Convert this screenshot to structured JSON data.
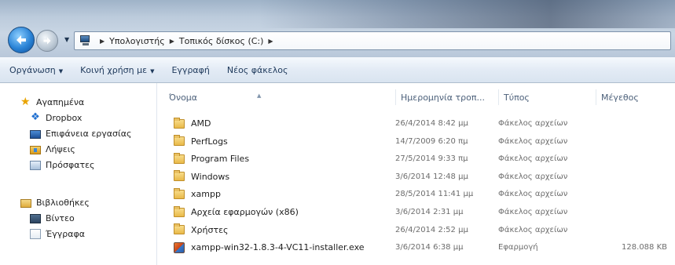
{
  "address": {
    "segments": [
      "Υπολογιστής",
      "Τοπικός δίσκος (C:)"
    ]
  },
  "toolbar": {
    "organize_label": "Οργάνωση",
    "share_label": "Κοινή χρήση με",
    "burn_label": "Εγγραφή",
    "new_folder_label": "Νέος φάκελος"
  },
  "navpane": {
    "favorites_label": "Αγαπημένα",
    "favorites": [
      "Dropbox",
      "Επιφάνεια εργασίας",
      "Λήψεις",
      "Πρόσφατες"
    ],
    "libraries_label": "Βιβλιοθήκες",
    "libraries": [
      "Βίντεο",
      "Έγγραφα"
    ]
  },
  "columns": {
    "name": "Όνομα",
    "date": "Ημερομηνία τροπ...",
    "type": "Τύπος",
    "size": "Μέγεθος"
  },
  "files": [
    {
      "name": "AMD",
      "date": "26/4/2014 8:42 μμ",
      "type": "Φάκελος αρχείων",
      "size": "",
      "icon": "folder-icon"
    },
    {
      "name": "PerfLogs",
      "date": "14/7/2009 6:20 πμ",
      "type": "Φάκελος αρχείων",
      "size": "",
      "icon": "folder-icon"
    },
    {
      "name": "Program Files",
      "date": "27/5/2014 9:33 πμ",
      "type": "Φάκελος αρχείων",
      "size": "",
      "icon": "folder-icon"
    },
    {
      "name": "Windows",
      "date": "3/6/2014 12:48 μμ",
      "type": "Φάκελος αρχείων",
      "size": "",
      "icon": "folder-icon"
    },
    {
      "name": "xampp",
      "date": "28/5/2014 11:41 μμ",
      "type": "Φάκελος αρχείων",
      "size": "",
      "icon": "folder-icon"
    },
    {
      "name": "Αρχεία εφαρμογών (x86)",
      "date": "3/6/2014 2:31 μμ",
      "type": "Φάκελος αρχείων",
      "size": "",
      "icon": "folder-icon"
    },
    {
      "name": "Χρήστες",
      "date": "26/4/2014 2:52 μμ",
      "type": "Φάκελος αρχείων",
      "size": "",
      "icon": "folder-icon"
    },
    {
      "name": "xampp-win32-1.8.3-4-VC11-installer.exe",
      "date": "3/6/2014 6:38 μμ",
      "type": "Εφαρμογή",
      "size": "128.088 KB",
      "icon": "installer-icon"
    }
  ]
}
